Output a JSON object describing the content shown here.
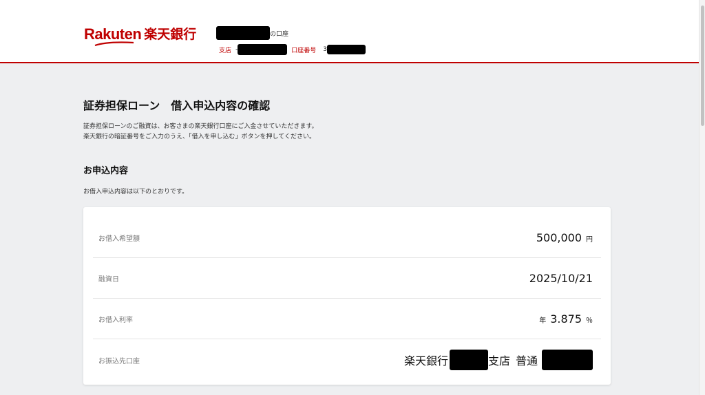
{
  "header": {
    "logo_text": "Rakuten",
    "logo_bank": "楽天銀行",
    "account_suffix": "の口座",
    "branch_label": "支店",
    "branch_value_prefix": "-",
    "account_number_label": "口座番号",
    "account_number_prefix": "3"
  },
  "main": {
    "title": "証券担保ローン　借入申込内容の確認",
    "intro_line1": "証券担保ローンのご融資は、お客さまの楽天銀行口座にご入金させていただきます。",
    "intro_line2": "楽天銀行の暗証番号をご入力のうえ、「借入を申し込む」ボタンを押してください。",
    "section_title": "お申込内容",
    "section_note": "お借入申込内容は以下のとおりです。"
  },
  "application": {
    "amount_label": "お借入希望額",
    "amount_value": "500,000",
    "amount_unit": "円",
    "date_label": "融資日",
    "date_value": "2025/10/21",
    "rate_label": "お借入利率",
    "rate_prefix": "年",
    "rate_value": "3.875",
    "rate_unit": "％",
    "account_label": "お振込先口座",
    "account_bank": "楽天銀行",
    "account_branch_suffix": "支店",
    "account_type": "普通"
  },
  "colors": {
    "brand_red": "#bf0000",
    "background": "#eeeff1"
  }
}
